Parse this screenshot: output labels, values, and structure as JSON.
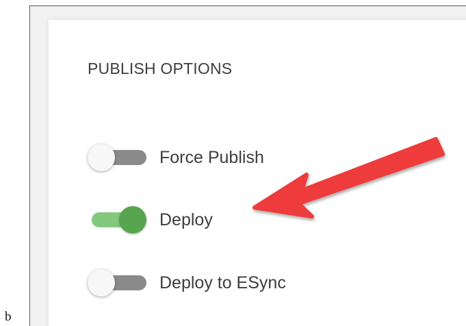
{
  "caption": {
    "letter": "b"
  },
  "panel": {
    "title": "PUBLISH OPTIONS",
    "options": [
      {
        "label": "Force Publish",
        "state": "off"
      },
      {
        "label": "Deploy",
        "state": "on"
      },
      {
        "label": "Deploy to ESync",
        "state": "off"
      }
    ]
  },
  "colors": {
    "toggle_on_track": "#84c87f",
    "toggle_on_thumb": "#58a54f",
    "toggle_off_track": "#8a8a8a",
    "toggle_off_thumb": "#f7f7f7",
    "annotation_arrow": "#ee3b3b"
  },
  "annotation": {
    "icon": "red-arrow-icon",
    "points_to": "Deploy"
  }
}
